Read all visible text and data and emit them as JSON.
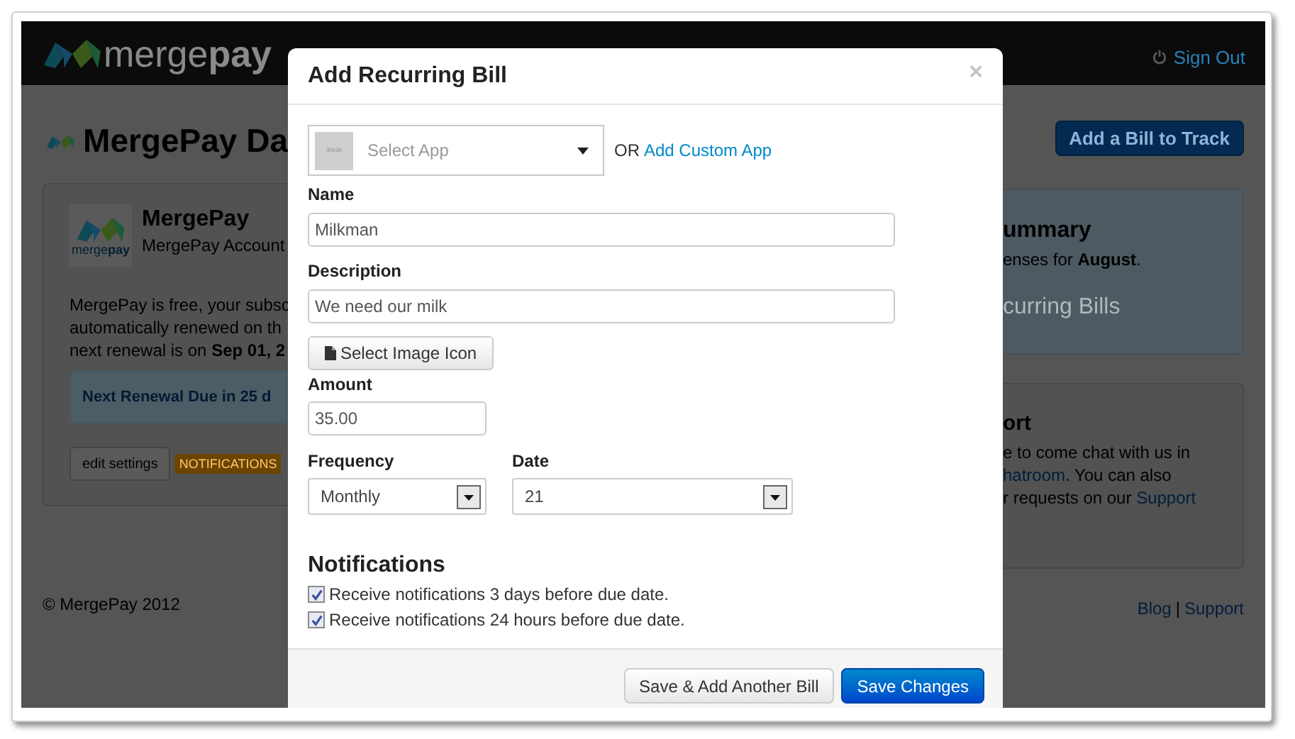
{
  "navbar": {
    "brand": "merge**pay**",
    "sign_out": "Sign Out"
  },
  "page": {
    "title": "MergePay Da",
    "add_button": "Add a Bill to Track"
  },
  "account_card": {
    "logo_text": "merge**pay**",
    "name": "MergePay",
    "subtitle": "MergePay Account",
    "paragraph": [
      "MergePay is free, your subsc",
      "automatically renewed on th",
      "next renewal is on **Sep 01, 2**"
    ],
    "alert": "Next Renewal Due in 25 d",
    "edit_button": "edit settings",
    "badge": "NOTIFICATIONS"
  },
  "summary_card": {
    "title": "ummary",
    "text": "enses for **August**.",
    "big_text": "curring Bills"
  },
  "support_card": {
    "title": "ort",
    "lines": [
      [
        {
          "kind": "text",
          "text": "e to come chat with us in"
        }
      ],
      [
        {
          "kind": "link",
          "text": "hatroom"
        },
        {
          "kind": "text",
          "text": ". You can also"
        }
      ],
      [
        {
          "kind": "text",
          "text": "r requests on our "
        },
        {
          "kind": "link",
          "text": "Support"
        }
      ]
    ]
  },
  "footer": {
    "copyright": "© MergePay 2012",
    "links": [
      "Blog",
      "Support"
    ],
    "separator": "|"
  },
  "modal": {
    "title": "Add Recurring Bill",
    "close": "×",
    "app_select": {
      "thumb": "30x30",
      "placeholder": "Select App"
    },
    "or_text": "OR",
    "custom_link": "Add Custom App",
    "fields": [
      {
        "label": "Name",
        "value": "Milkman"
      },
      {
        "label": "Description",
        "value": "We need our milk"
      }
    ],
    "image_button": "Select Image Icon",
    "amount": {
      "label": "Amount",
      "value": "35.00"
    },
    "frequency": {
      "label": "Frequency",
      "value": "Monthly"
    },
    "date": {
      "label": "Date",
      "value": "21"
    },
    "notifications": {
      "title": "Notifications",
      "options": [
        {
          "label": "Receive notifications 3 days before due date.",
          "checked": true
        },
        {
          "label": "Receive notifications 24 hours before due date.",
          "checked": true
        }
      ]
    },
    "buttons": [
      {
        "label": "Save & Add Another Bill",
        "kind": "secondary"
      },
      {
        "label": "Save Changes",
        "kind": "primary"
      }
    ]
  }
}
